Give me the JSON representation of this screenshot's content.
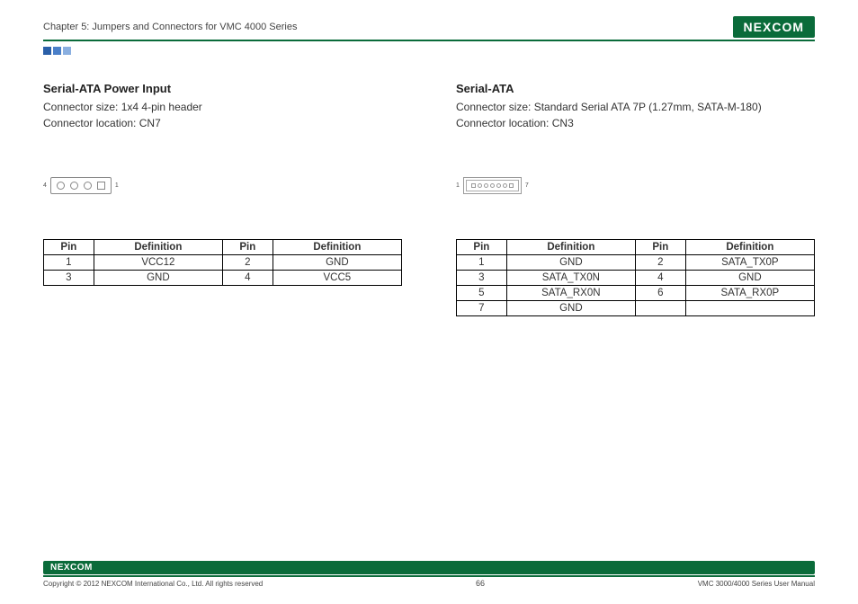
{
  "header": {
    "chapter": "Chapter 5: Jumpers and Connectors for VMC 4000 Series",
    "logo": "NEXCOM"
  },
  "left": {
    "title": "Serial-ATA Power Input",
    "size_label": "Connector size: ",
    "size_value": "1x4 4-pin header",
    "loc_label": "Connector location: ",
    "loc_value": "CN7",
    "conn_left_num": "4",
    "conn_right_num": "1",
    "headers": {
      "pin": "Pin",
      "def": "Definition"
    },
    "rows": [
      {
        "p1": "1",
        "d1": "VCC12",
        "p2": "2",
        "d2": "GND"
      },
      {
        "p1": "3",
        "d1": "GND",
        "p2": "4",
        "d2": "VCC5"
      }
    ]
  },
  "right": {
    "title": "Serial-ATA",
    "size_label": "Connector size: ",
    "size_value": "Standard Serial ATA 7P (1.27mm, SATA-M-180)",
    "loc_label": "Connector location: ",
    "loc_value": "CN3",
    "conn_left_num": "1",
    "conn_right_num": "7",
    "headers": {
      "pin": "Pin",
      "def": "Definition"
    },
    "rows": [
      {
        "p1": "1",
        "d1": "GND",
        "p2": "2",
        "d2": "SATA_TX0P"
      },
      {
        "p1": "3",
        "d1": "SATA_TX0N",
        "p2": "4",
        "d2": "GND"
      },
      {
        "p1": "5",
        "d1": "SATA_RX0N",
        "p2": "6",
        "d2": "SATA_RX0P"
      },
      {
        "p1": "7",
        "d1": "GND",
        "p2": "",
        "d2": ""
      }
    ]
  },
  "footer": {
    "logo": "NEXCOM",
    "copyright": "Copyright © 2012 NEXCOM International Co., Ltd. All rights reserved",
    "page": "66",
    "manual": "VMC 3000/4000 Series User Manual"
  }
}
